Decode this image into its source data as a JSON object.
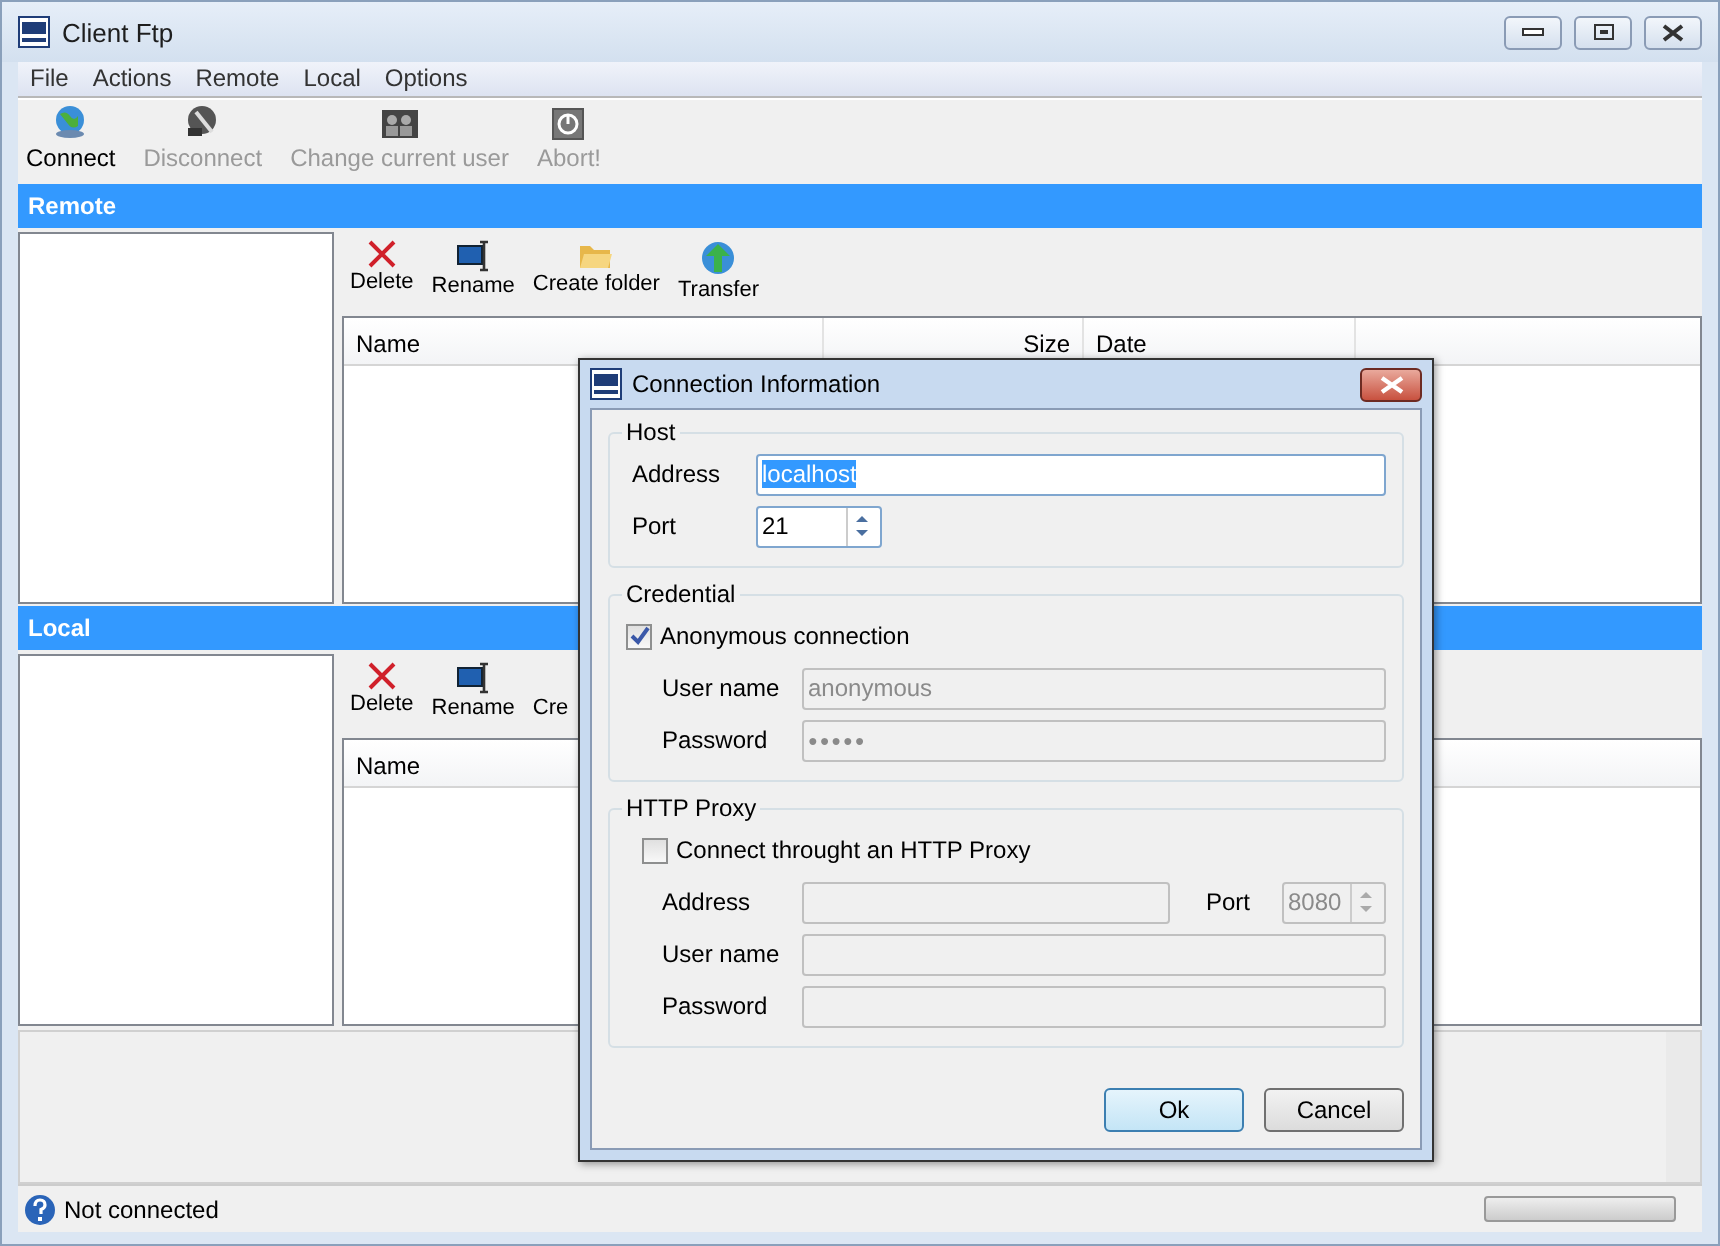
{
  "window": {
    "title": "Client Ftp"
  },
  "menu": [
    "File",
    "Actions",
    "Remote",
    "Local",
    "Options"
  ],
  "toolbar": [
    {
      "label": "Connect",
      "disabled": false
    },
    {
      "label": "Disconnect",
      "disabled": true
    },
    {
      "label": "Change current user",
      "disabled": true
    },
    {
      "label": "Abort!",
      "disabled": true
    }
  ],
  "remote": {
    "title": "Remote",
    "actions": [
      "Delete",
      "Rename",
      "Create folder",
      "Transfer"
    ],
    "columns": [
      "Name",
      "Size",
      "Date"
    ]
  },
  "local": {
    "title": "Local",
    "actions": [
      "Delete",
      "Rename",
      "Cre"
    ],
    "columns": [
      "Name"
    ]
  },
  "status_bar": {
    "text": "Not connected",
    "progress": {
      "level": 0
    }
  },
  "dialog": {
    "title": "Connection Information",
    "host": {
      "title": "Host",
      "address_label": "Address",
      "address": "localhost",
      "port_label": "Port",
      "port": "21"
    },
    "credential": {
      "title": "Credential",
      "anonymous": {
        "label": "Anonymous connection",
        "checked": true
      },
      "user_label": "User name",
      "user": "anonymous",
      "password_label": "Password",
      "password": "●●●●●"
    },
    "proxy": {
      "title": "HTTP Proxy",
      "use_proxy": {
        "label": "Connect throught an HTTP Proxy",
        "checked": false
      },
      "address_label": "Address",
      "port_label": "Port",
      "port": "8080",
      "user_label": "User name",
      "password_label": "Password"
    },
    "buttons": [
      {
        "label": "Ok",
        "default": true
      },
      {
        "label": "Cancel",
        "default": false
      }
    ]
  }
}
